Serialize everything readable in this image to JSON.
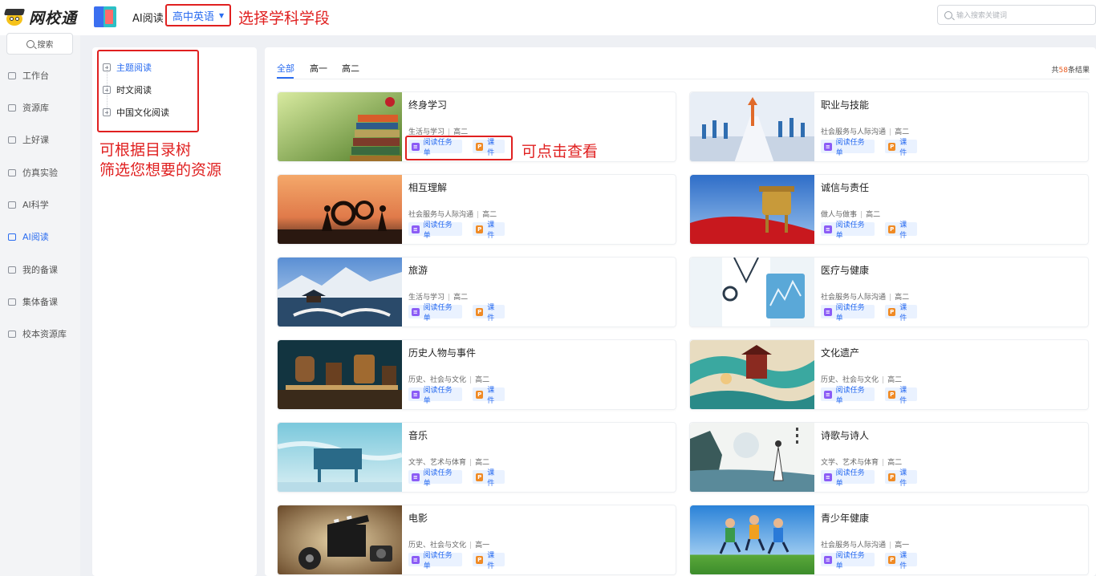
{
  "header": {
    "logo_text": "网校通",
    "app_title": "AI阅读",
    "subject_selected": "高中英语",
    "annotation_subject": "选择学科学段",
    "search_placeholder": "输入搜索关键词"
  },
  "sidebar": {
    "search_label": "搜索",
    "items": [
      {
        "label": "工作台",
        "icon": "monitor-icon"
      },
      {
        "label": "资源库",
        "icon": "edit-icon"
      },
      {
        "label": "上好课",
        "icon": "screen-icon"
      },
      {
        "label": "仿真实验",
        "icon": "flask-icon"
      },
      {
        "label": "AI科学",
        "icon": "leaf-icon"
      },
      {
        "label": "AI阅读",
        "icon": "book-icon",
        "active": true
      },
      {
        "label": "我的备课",
        "icon": "folder-icon"
      },
      {
        "label": "集体备课",
        "icon": "group-icon"
      },
      {
        "label": "校本资源库",
        "icon": "library-icon"
      }
    ]
  },
  "tree": {
    "items": [
      {
        "label": "主题阅读",
        "active": true
      },
      {
        "label": "时文阅读"
      },
      {
        "label": "中国文化阅读"
      }
    ],
    "annotation_line1": "可根据目录树",
    "annotation_line2": "筛选您想要的资源"
  },
  "content": {
    "tabs": [
      "全部",
      "高一",
      "高二"
    ],
    "result_prefix": "共",
    "result_count": "58",
    "result_suffix": "条结果",
    "tag_task_label": "阅读任务单",
    "tag_ppt_label": "课件",
    "annotation_click": "可点击查看",
    "cards": [
      {
        "title": "终身学习",
        "category": "生活与学习",
        "grade": "高二"
      },
      {
        "title": "职业与技能",
        "category": "社会服务与人际沟通",
        "grade": "高二"
      },
      {
        "title": "相互理解",
        "category": "社会服务与人际沟通",
        "grade": "高二"
      },
      {
        "title": "诚信与责任",
        "category": "做人与做事",
        "grade": "高二"
      },
      {
        "title": "旅游",
        "category": "生活与学习",
        "grade": "高二"
      },
      {
        "title": "医疗与健康",
        "category": "社会服务与人际沟通",
        "grade": "高二"
      },
      {
        "title": "历史人物与事件",
        "category": "历史、社会与文化",
        "grade": "高二"
      },
      {
        "title": "文化遗产",
        "category": "历史、社会与文化",
        "grade": "高二"
      },
      {
        "title": "音乐",
        "category": "文学、艺术与体育",
        "grade": "高二"
      },
      {
        "title": "诗歌与诗人",
        "category": "文学、艺术与体育",
        "grade": "高二"
      },
      {
        "title": "电影",
        "category": "历史、社会与文化",
        "grade": "高一"
      },
      {
        "title": "青少年健康",
        "category": "社会服务与人际沟通",
        "grade": "高一"
      }
    ]
  },
  "colors": {
    "accent": "#2a6cf0",
    "annotation": "#e02020",
    "count_highlight": "#e8581c"
  }
}
